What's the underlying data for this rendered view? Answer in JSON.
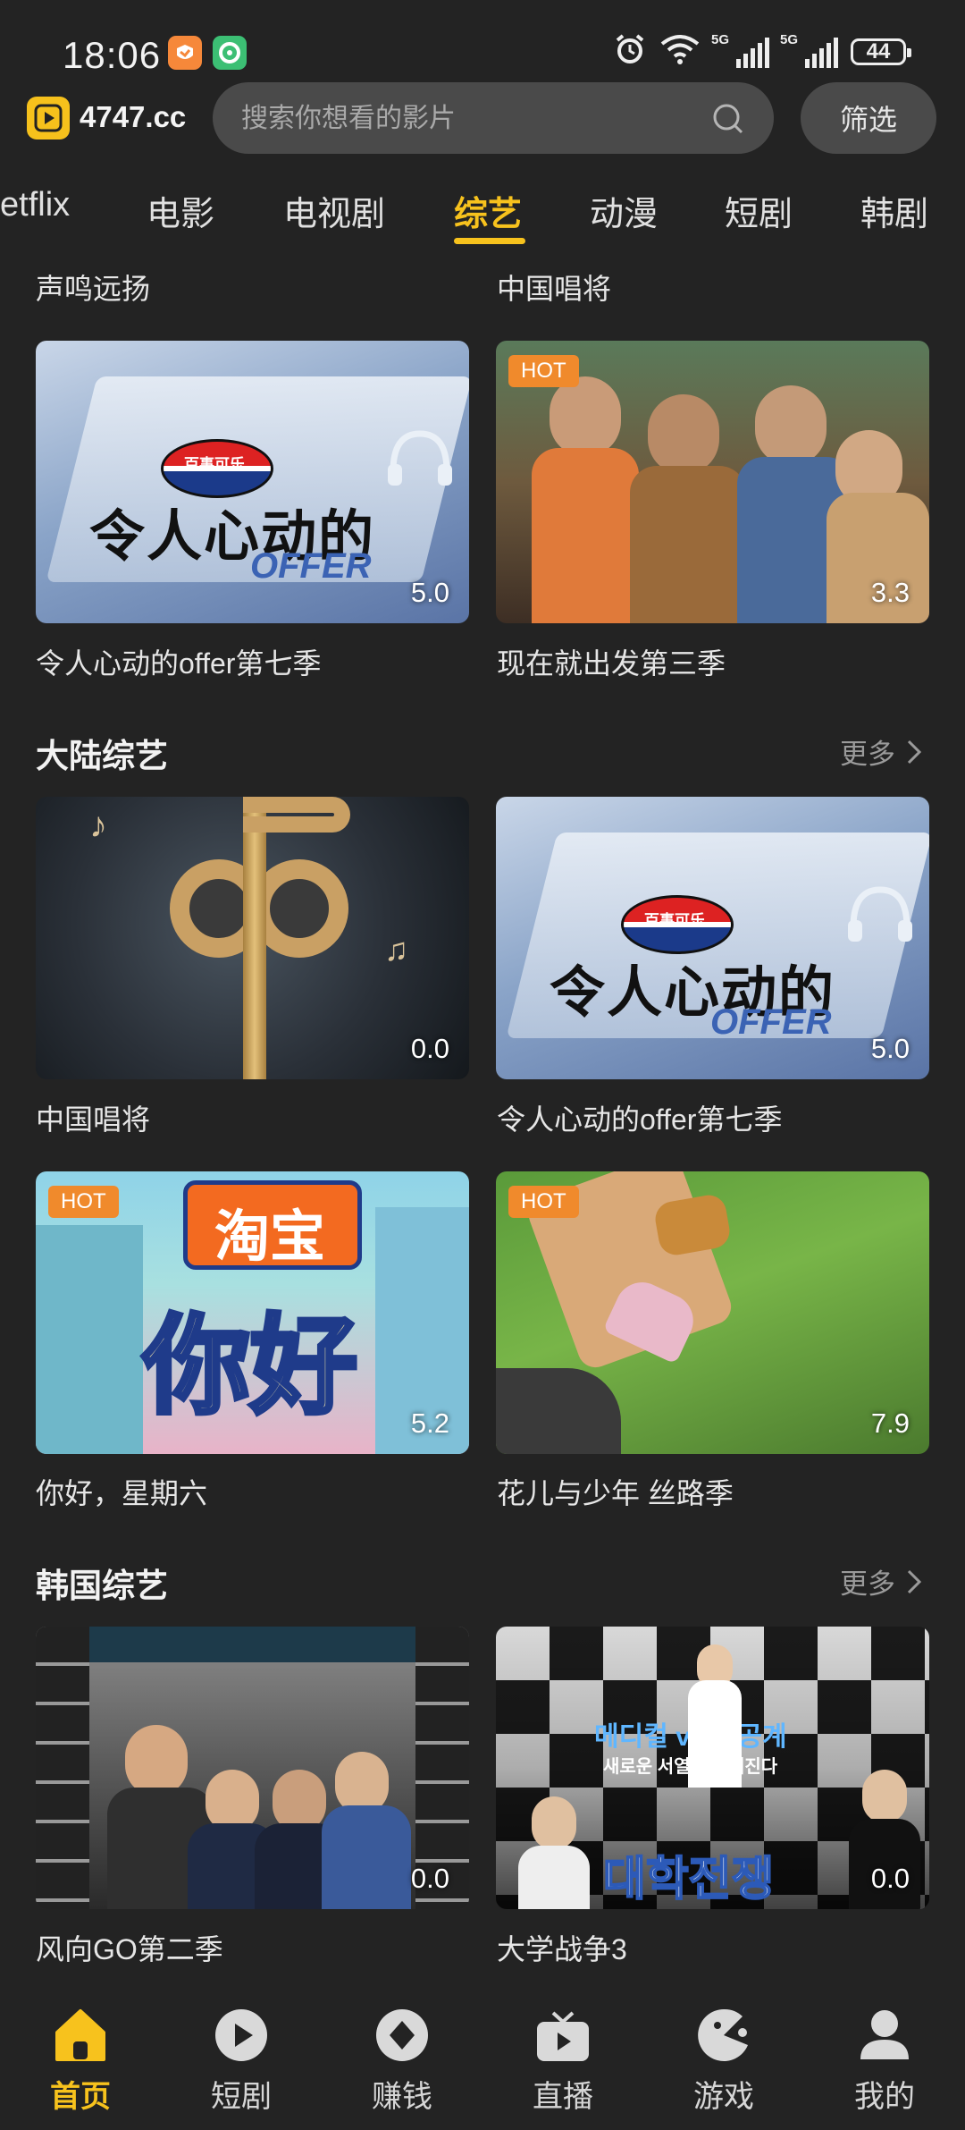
{
  "status": {
    "time": "18:06",
    "network_tag_1": "5G",
    "network_tag_2": "5G",
    "battery": "44"
  },
  "header": {
    "logo_text": "4747.cc",
    "search_placeholder": "搜索你想看的影片",
    "filter_label": "筛选"
  },
  "tabs": [
    "etflix",
    "电影",
    "电视剧",
    "综艺",
    "动漫",
    "短剧",
    "韩剧"
  ],
  "active_tab": "综艺",
  "partial_section": {
    "titles": [
      "声鸣远扬",
      "中国唱将"
    ],
    "items": [
      {
        "title": "令人心动的offer第七季",
        "score": "5.0",
        "hot": ""
      },
      {
        "title": "现在就出发第三季",
        "score": "3.3",
        "hot": "HOT"
      }
    ]
  },
  "section_mainland": {
    "title": "大陆综艺",
    "more": "更多",
    "items": [
      {
        "title": "中国唱将",
        "score": "0.0",
        "hot": ""
      },
      {
        "title": "令人心动的offer第七季",
        "score": "5.0",
        "hot": ""
      },
      {
        "title": "你好，星期六",
        "score": "5.2",
        "hot": "HOT"
      },
      {
        "title": "花儿与少年 丝路季",
        "score": "7.9",
        "hot": "HOT"
      }
    ]
  },
  "section_korea": {
    "title": "韩国综艺",
    "more": "更多",
    "items": [
      {
        "title": "风向GO第二季",
        "score": "0.0",
        "hot": ""
      },
      {
        "title": "大学战争3",
        "score": "0.0",
        "hot": ""
      }
    ]
  },
  "poster_text": {
    "pepsi": "百事可乐",
    "offer_cn": "令人心动的",
    "offer_en": "OFFER",
    "taobao": "淘宝",
    "nihao": "你好",
    "korea_sub": "메디컬 vs 이공계",
    "korea_sub2": "새로운 서열이 정해진다",
    "korea_title": "대학전쟁"
  },
  "bottom_nav": [
    {
      "label": "首页",
      "icon": "home-icon"
    },
    {
      "label": "短剧",
      "icon": "play-icon"
    },
    {
      "label": "赚钱",
      "icon": "diamond-icon"
    },
    {
      "label": "直播",
      "icon": "tv-icon"
    },
    {
      "label": "游戏",
      "icon": "game-icon"
    },
    {
      "label": "我的",
      "icon": "user-icon"
    }
  ],
  "colors": {
    "accent": "#f7c21d",
    "background": "#232323",
    "hot_badge": "#f08a2c"
  }
}
